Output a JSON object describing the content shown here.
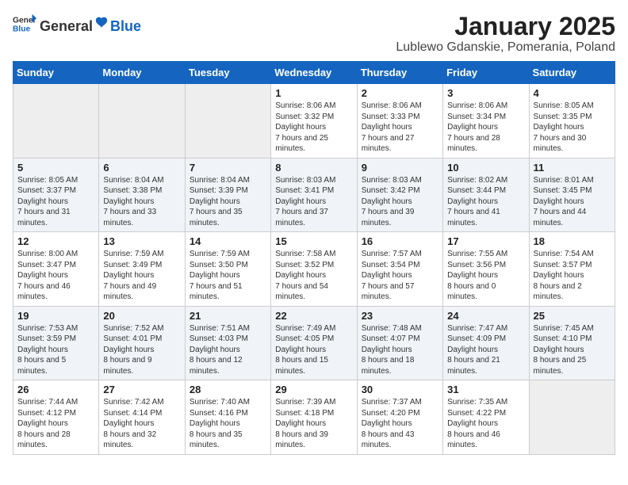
{
  "header": {
    "logo_general": "General",
    "logo_blue": "Blue",
    "month_title": "January 2025",
    "location": "Lublewo Gdanskie, Pomerania, Poland"
  },
  "weekdays": [
    "Sunday",
    "Monday",
    "Tuesday",
    "Wednesday",
    "Thursday",
    "Friday",
    "Saturday"
  ],
  "weeks": [
    [
      {
        "day": "",
        "empty": true
      },
      {
        "day": "",
        "empty": true
      },
      {
        "day": "",
        "empty": true
      },
      {
        "day": "1",
        "sunrise": "8:06 AM",
        "sunset": "3:32 PM",
        "daylight": "7 hours and 25 minutes."
      },
      {
        "day": "2",
        "sunrise": "8:06 AM",
        "sunset": "3:33 PM",
        "daylight": "7 hours and 27 minutes."
      },
      {
        "day": "3",
        "sunrise": "8:06 AM",
        "sunset": "3:34 PM",
        "daylight": "7 hours and 28 minutes."
      },
      {
        "day": "4",
        "sunrise": "8:05 AM",
        "sunset": "3:35 PM",
        "daylight": "7 hours and 30 minutes."
      }
    ],
    [
      {
        "day": "5",
        "sunrise": "8:05 AM",
        "sunset": "3:37 PM",
        "daylight": "7 hours and 31 minutes."
      },
      {
        "day": "6",
        "sunrise": "8:04 AM",
        "sunset": "3:38 PM",
        "daylight": "7 hours and 33 minutes."
      },
      {
        "day": "7",
        "sunrise": "8:04 AM",
        "sunset": "3:39 PM",
        "daylight": "7 hours and 35 minutes."
      },
      {
        "day": "8",
        "sunrise": "8:03 AM",
        "sunset": "3:41 PM",
        "daylight": "7 hours and 37 minutes."
      },
      {
        "day": "9",
        "sunrise": "8:03 AM",
        "sunset": "3:42 PM",
        "daylight": "7 hours and 39 minutes."
      },
      {
        "day": "10",
        "sunrise": "8:02 AM",
        "sunset": "3:44 PM",
        "daylight": "7 hours and 41 minutes."
      },
      {
        "day": "11",
        "sunrise": "8:01 AM",
        "sunset": "3:45 PM",
        "daylight": "7 hours and 44 minutes."
      }
    ],
    [
      {
        "day": "12",
        "sunrise": "8:00 AM",
        "sunset": "3:47 PM",
        "daylight": "7 hours and 46 minutes."
      },
      {
        "day": "13",
        "sunrise": "7:59 AM",
        "sunset": "3:49 PM",
        "daylight": "7 hours and 49 minutes."
      },
      {
        "day": "14",
        "sunrise": "7:59 AM",
        "sunset": "3:50 PM",
        "daylight": "7 hours and 51 minutes."
      },
      {
        "day": "15",
        "sunrise": "7:58 AM",
        "sunset": "3:52 PM",
        "daylight": "7 hours and 54 minutes."
      },
      {
        "day": "16",
        "sunrise": "7:57 AM",
        "sunset": "3:54 PM",
        "daylight": "7 hours and 57 minutes."
      },
      {
        "day": "17",
        "sunrise": "7:55 AM",
        "sunset": "3:56 PM",
        "daylight": "8 hours and 0 minutes."
      },
      {
        "day": "18",
        "sunrise": "7:54 AM",
        "sunset": "3:57 PM",
        "daylight": "8 hours and 2 minutes."
      }
    ],
    [
      {
        "day": "19",
        "sunrise": "7:53 AM",
        "sunset": "3:59 PM",
        "daylight": "8 hours and 5 minutes."
      },
      {
        "day": "20",
        "sunrise": "7:52 AM",
        "sunset": "4:01 PM",
        "daylight": "8 hours and 9 minutes."
      },
      {
        "day": "21",
        "sunrise": "7:51 AM",
        "sunset": "4:03 PM",
        "daylight": "8 hours and 12 minutes."
      },
      {
        "day": "22",
        "sunrise": "7:49 AM",
        "sunset": "4:05 PM",
        "daylight": "8 hours and 15 minutes."
      },
      {
        "day": "23",
        "sunrise": "7:48 AM",
        "sunset": "4:07 PM",
        "daylight": "8 hours and 18 minutes."
      },
      {
        "day": "24",
        "sunrise": "7:47 AM",
        "sunset": "4:09 PM",
        "daylight": "8 hours and 21 minutes."
      },
      {
        "day": "25",
        "sunrise": "7:45 AM",
        "sunset": "4:10 PM",
        "daylight": "8 hours and 25 minutes."
      }
    ],
    [
      {
        "day": "26",
        "sunrise": "7:44 AM",
        "sunset": "4:12 PM",
        "daylight": "8 hours and 28 minutes."
      },
      {
        "day": "27",
        "sunrise": "7:42 AM",
        "sunset": "4:14 PM",
        "daylight": "8 hours and 32 minutes."
      },
      {
        "day": "28",
        "sunrise": "7:40 AM",
        "sunset": "4:16 PM",
        "daylight": "8 hours and 35 minutes."
      },
      {
        "day": "29",
        "sunrise": "7:39 AM",
        "sunset": "4:18 PM",
        "daylight": "8 hours and 39 minutes."
      },
      {
        "day": "30",
        "sunrise": "7:37 AM",
        "sunset": "4:20 PM",
        "daylight": "8 hours and 43 minutes."
      },
      {
        "day": "31",
        "sunrise": "7:35 AM",
        "sunset": "4:22 PM",
        "daylight": "8 hours and 46 minutes."
      },
      {
        "day": "",
        "empty": true
      }
    ]
  ]
}
